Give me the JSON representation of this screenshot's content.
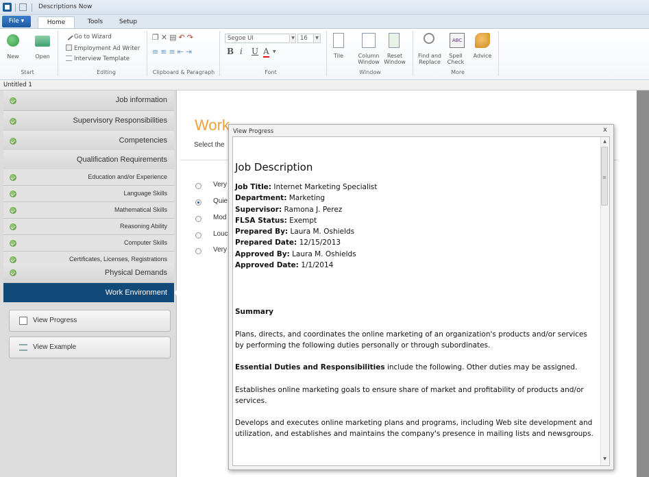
{
  "app": {
    "title": "Descriptions Now"
  },
  "ribbon": {
    "file_label": "File ▾",
    "tabs": [
      "Home",
      "Tools",
      "Setup"
    ],
    "start": {
      "new": "New",
      "open": "Open",
      "group": "Start"
    },
    "editing": {
      "wizard": "Go to Wizard",
      "employment_ad": "Employment Ad Writer",
      "interview": "Interview Template",
      "group": "Editing"
    },
    "clipboard": {
      "group": "Clipboard & Paragraph"
    },
    "font": {
      "family": "Segoe UI",
      "size": "16",
      "group": "Font",
      "bold": "B",
      "italic": "i",
      "underline": "U",
      "color": "A"
    },
    "window": {
      "tile": "Tile",
      "column_window": "Column Window",
      "reset_window": "Reset Window",
      "group": "Window"
    },
    "more": {
      "find_replace": "Find and Replace",
      "spell_check": "Spell Check",
      "advice": "Advice",
      "group": "More",
      "abc": "ABC"
    }
  },
  "doc_tab": "Untitled 1",
  "sidebar": {
    "items": [
      {
        "label": "Job information",
        "checked": true
      },
      {
        "label": "Supervisory Responsibilities",
        "checked": true
      },
      {
        "label": "Competencies",
        "checked": true
      },
      {
        "label": "Qualification Requirements",
        "checked": false
      },
      {
        "label": "Education and/or Experience",
        "checked": true
      },
      {
        "label": "Language Skills",
        "checked": true
      },
      {
        "label": "Mathematical Skills",
        "checked": true
      },
      {
        "label": "Reasoning Ability",
        "checked": true
      },
      {
        "label": "Computer Skills",
        "checked": true
      },
      {
        "label": "Certificates, Licenses, Registrations",
        "checked": true
      },
      {
        "label": "Physical Demands",
        "checked": true
      }
    ],
    "active": "Work Environment",
    "view_progress": "View Progress",
    "view_example": "View Example"
  },
  "main": {
    "title": "Work Environment",
    "subtitle": "Select the",
    "options": [
      "Very",
      "Quie",
      "Mod",
      "Louc",
      "Very"
    ],
    "selected_index": 1
  },
  "dialog": {
    "title": "View Progress",
    "close": "x",
    "doc": {
      "heading": "Job Description",
      "fields": [
        {
          "k": "Job Title:",
          "v": "Internet Marketing Specialist"
        },
        {
          "k": "Department:",
          "v": "Marketing"
        },
        {
          "k": "Supervisor:",
          "v": "Ramona J. Perez"
        },
        {
          "k": "FLSA Status:",
          "v": "Exempt"
        },
        {
          "k": "Prepared By:",
          "v": "Laura M. Oshields"
        },
        {
          "k": "Prepared Date:",
          "v": "12/15/2013"
        },
        {
          "k": "Approved By:",
          "v": "Laura M. Oshields"
        },
        {
          "k": "Approved Date:",
          "v": "1/1/2014"
        }
      ],
      "summary_heading": "Summary",
      "summary": "Plans, directs, and coordinates the online marketing of an organization's products and/or services by performing the following duties personally or through subordinates.",
      "duties_bold": "Essential Duties and Responsibilities",
      "duties_rest": " include the following. Other duties may be assigned.",
      "para1": "Establishes online marketing goals to ensure share of market and profitability of products and/or services.",
      "para2": "Develops and executes online marketing plans and programs, including Web site development and utilization, and establishes and maintains the company's presence in mailing lists and newsgroups."
    }
  }
}
